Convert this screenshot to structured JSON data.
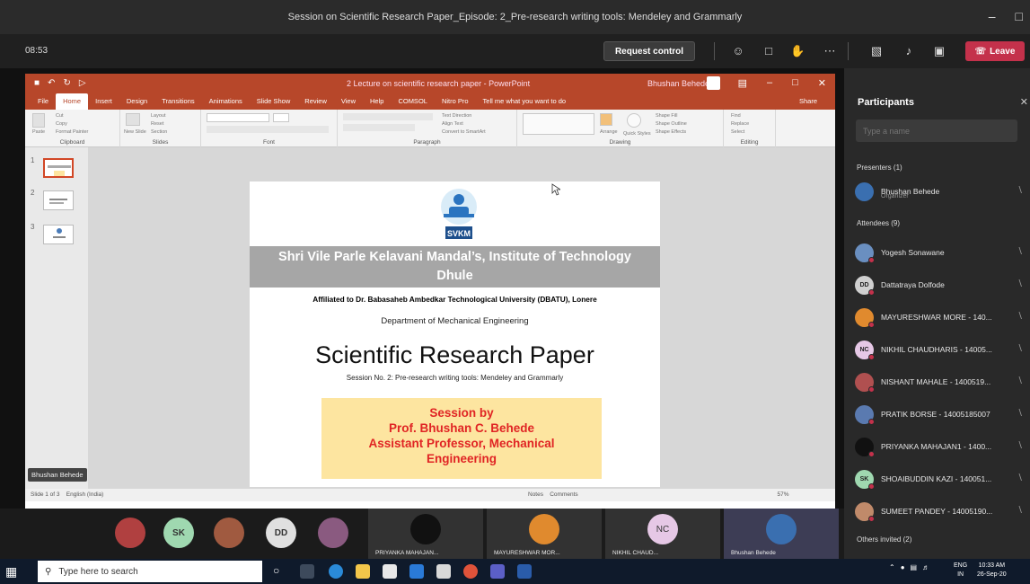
{
  "window": {
    "title": "Session on Scientific Research Paper_Episode: 2_Pre-research writing tools: Mendeley and Grammarly"
  },
  "meeting": {
    "timer": "08:53",
    "request_control": "Request control",
    "leave": "Leave"
  },
  "ppt": {
    "doc_title": "2 Lecture on scientific research paper - PowerPoint",
    "user": "Bhushan Behede",
    "tabs": [
      "File",
      "Home",
      "Insert",
      "Design",
      "Transitions",
      "Animations",
      "Slide Show",
      "Review",
      "View",
      "Help",
      "COMSOL",
      "Nitro Pro",
      "Tell me what you want to do"
    ],
    "share": "Share",
    "ribbon_groups": [
      "Clipboard",
      "Slides",
      "Font",
      "Paragraph",
      "Drawing",
      "Editing"
    ],
    "ribbon": {
      "paste": "Paste",
      "cut": "Cut",
      "copy": "Copy",
      "format_painter": "Format Painter",
      "new_slide": "New Slide",
      "layout": "Layout",
      "reset": "Reset",
      "section": "Section",
      "text_direction": "Text Direction",
      "align_text": "Align Text",
      "convert_smartart": "Convert to SmartArt",
      "arrange": "Arrange",
      "quick_styles": "Quick Styles",
      "shape_fill": "Shape Fill",
      "shape_outline": "Shape Outline",
      "shape_effects": "Shape Effects",
      "find": "Find",
      "replace": "Replace",
      "select": "Select"
    },
    "status_left": "Slide 1 of 3",
    "status_lang": "English (India)",
    "status_notes": "Notes",
    "status_comments": "Comments",
    "zoom": "57%",
    "thumb_numbers": [
      "1",
      "2",
      "3"
    ]
  },
  "slide": {
    "logo_text": "SVKM",
    "institute_line1": "Shri Vile Parle Kelavani Mandal’s, Institute of Technology",
    "institute_line2": "Dhule",
    "affiliation": "Affiliated to Dr. Babasaheb Ambedkar Technological University (DBATU), Lonere",
    "department": "Department of Mechanical Engineering",
    "title": "Scientific Research Paper",
    "subtitle": "Session No. 2: Pre-research writing tools: Mendeley and Grammarly",
    "session_line1": "Session by",
    "session_line2": "Prof. Bhushan C. Behede",
    "session_line3": "Assistant Professor, Mechanical",
    "session_line4": "Engineering"
  },
  "presenter_tag": "Bhushan Behede",
  "participants": {
    "title": "Participants",
    "search_placeholder": "Type a name",
    "presenters_label": "Presenters (1)",
    "presenters": [
      {
        "name": "Bhushan Behede",
        "role": "Organizer",
        "initials": "",
        "color": "#3a6fb0"
      }
    ],
    "attendees_label": "Attendees (9)",
    "attendees": [
      {
        "name": "Yogesh Sonawane",
        "initials": "",
        "color": "#6a8fc0"
      },
      {
        "name": "Dattatraya Dolfode",
        "initials": "DD",
        "color": "#d0d0d0"
      },
      {
        "name": "MAYURESHWAR MORE - 140...",
        "initials": "",
        "color": "#e08a2e"
      },
      {
        "name": "NIKHIL CHAUDHARIS - 14005...",
        "initials": "NC",
        "color": "#e6c8e6"
      },
      {
        "name": "NISHANT MAHALE - 1400519...",
        "initials": "",
        "color": "#b05050"
      },
      {
        "name": "PRATIK BORSE - 14005185007",
        "initials": "",
        "color": "#5a7ab0"
      },
      {
        "name": "PRIYANKA MAHAJAN1 - 1400...",
        "initials": "",
        "color": "#111111"
      },
      {
        "name": "SHOAIBUDDIN KAZI - 140051...",
        "initials": "SK",
        "color": "#9fd8b0"
      },
      {
        "name": "SUMEET PANDEY - 14005190...",
        "initials": "",
        "color": "#c08a6a"
      }
    ],
    "others_label": "Others invited (2)"
  },
  "gallery": {
    "avatars": [
      {
        "initials": "",
        "color": "#b04040"
      },
      {
        "initials": "SK",
        "color": "#9fd8b0"
      },
      {
        "initials": "",
        "color": "#a05a40"
      },
      {
        "initials": "DD",
        "color": "#e0e0e0"
      },
      {
        "initials": "",
        "color": "#8a5a80"
      }
    ],
    "tiles": [
      {
        "name": "PRIYANKA MAHAJAN...",
        "color": "#111111"
      },
      {
        "name": "MAYURESHWAR MOR...",
        "color": "#e08a2e"
      },
      {
        "name": "NIKHIL CHAUD...",
        "color": "#e6c8e6",
        "initials": "NC"
      },
      {
        "name": "Bhushan Behede",
        "color": "#3a6fb0"
      }
    ]
  },
  "taskbar": {
    "search_placeholder": "Type here to search",
    "lang_top": "ENG",
    "lang_bottom": "IN",
    "time": "10:33 AM",
    "date": "26-Sep-20"
  }
}
